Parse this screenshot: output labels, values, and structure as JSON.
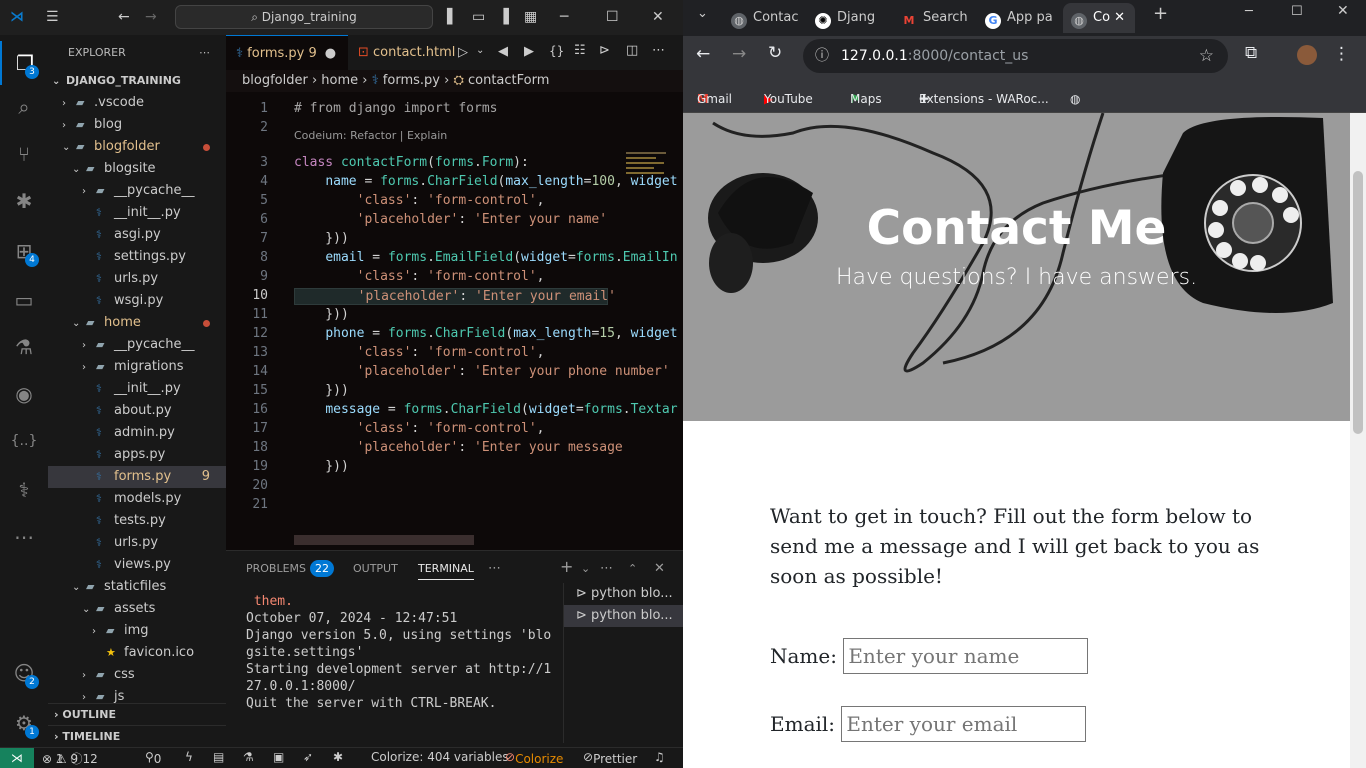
{
  "vscode": {
    "command_center": "Django_training",
    "explorer_title": "EXPLORER",
    "project": "DJANGO_TRAINING",
    "tree": [
      {
        "label": ".vscode",
        "type": "folder",
        "indent": 1
      },
      {
        "label": "blog",
        "type": "folder",
        "indent": 1
      },
      {
        "label": "blogfolder",
        "type": "folder-open",
        "indent": 1,
        "modified": true
      },
      {
        "label": "blogsite",
        "type": "folder-open",
        "indent": 2
      },
      {
        "label": "__pycache__",
        "type": "folder",
        "indent": 3
      },
      {
        "label": "__init__.py",
        "type": "py",
        "indent": 3
      },
      {
        "label": "asgi.py",
        "type": "py",
        "indent": 3
      },
      {
        "label": "settings.py",
        "type": "py",
        "indent": 3
      },
      {
        "label": "urls.py",
        "type": "py",
        "indent": 3
      },
      {
        "label": "wsgi.py",
        "type": "py",
        "indent": 3
      },
      {
        "label": "home",
        "type": "folder-open",
        "indent": 2,
        "modified": true
      },
      {
        "label": "__pycache__",
        "type": "folder",
        "indent": 3
      },
      {
        "label": "migrations",
        "type": "folder",
        "indent": 3
      },
      {
        "label": "__init__.py",
        "type": "py",
        "indent": 3
      },
      {
        "label": "about.py",
        "type": "py",
        "indent": 3
      },
      {
        "label": "admin.py",
        "type": "py",
        "indent": 3
      },
      {
        "label": "apps.py",
        "type": "py",
        "indent": 3
      },
      {
        "label": "forms.py",
        "type": "py",
        "indent": 3,
        "selected": true,
        "count": "9"
      },
      {
        "label": "models.py",
        "type": "py",
        "indent": 3
      },
      {
        "label": "tests.py",
        "type": "py",
        "indent": 3
      },
      {
        "label": "urls.py",
        "type": "py",
        "indent": 3
      },
      {
        "label": "views.py",
        "type": "py",
        "indent": 3
      },
      {
        "label": "staticfiles",
        "type": "folder-open",
        "indent": 2
      },
      {
        "label": "assets",
        "type": "folder-open",
        "indent": 3
      },
      {
        "label": "img",
        "type": "folder",
        "indent": 4
      },
      {
        "label": "favicon.ico",
        "type": "ico",
        "indent": 4
      },
      {
        "label": "css",
        "type": "folder",
        "indent": 3
      },
      {
        "label": "js",
        "type": "folder",
        "indent": 3
      }
    ],
    "sections": [
      "OUTLINE",
      "TIMELINE"
    ],
    "activity_badges": {
      "explorer": "3",
      "extensions": "4",
      "accounts": "2",
      "remote": "1"
    },
    "tabs": [
      {
        "label": "forms.py 9",
        "active": true
      },
      {
        "label": "contact.html",
        "active": false
      }
    ],
    "breadcrumb": [
      "blogfolder",
      "home",
      "forms.py",
      "contactForm"
    ],
    "codelens": "Codeium: Refactor | Explain",
    "code_lines": [
      {
        "n": "1",
        "html": "<span class='c'># from django import forms</span>"
      },
      {
        "n": "2",
        "html": ""
      },
      {
        "n": "3",
        "html": "<span class='k'>class</span> <span class='t'>contactForm</span>(<span class='t'>forms</span>.<span class='t'>Form</span>):"
      },
      {
        "n": "4",
        "html": "    <span class='p'>name</span> = <span class='t'>forms</span>.<span class='t'>CharField</span>(<span class='p'>max_length</span>=<span class='n'>100</span>, <span class='p'>widget</span>"
      },
      {
        "n": "5",
        "html": "        <span class='s'>'class'</span>: <span class='s'>'form-control'</span>,"
      },
      {
        "n": "6",
        "html": "        <span class='s'>'placeholder'</span>: <span class='s'>'Enter your name'</span>"
      },
      {
        "n": "7",
        "html": "    }))"
      },
      {
        "n": "8",
        "html": "    <span class='p'>email</span> = <span class='t'>forms</span>.<span class='t'>EmailField</span>(<span class='p'>widget</span>=<span class='t'>forms</span>.<span class='t'>EmailIn</span>"
      },
      {
        "n": "9",
        "html": "        <span class='s'>'class'</span>: <span class='s'>'form-control'</span>,"
      },
      {
        "n": "10",
        "html": "        <span class='s'>'placeholder'</span>: <span class='s'>'Enter your email'</span>",
        "current": true
      },
      {
        "n": "11",
        "html": "    }))"
      },
      {
        "n": "12",
        "html": "    <span class='p'>phone</span> = <span class='t'>forms</span>.<span class='t'>CharField</span>(<span class='p'>max_length</span>=<span class='n'>15</span>, <span class='p'>widget</span>"
      },
      {
        "n": "13",
        "html": "        <span class='s'>'class'</span>: <span class='s'>'form-control'</span>,"
      },
      {
        "n": "14",
        "html": "        <span class='s'>'placeholder'</span>: <span class='s'>'Enter your phone number'</span>"
      },
      {
        "n": "15",
        "html": "    }))"
      },
      {
        "n": "16",
        "html": "    <span class='p'>message</span> = <span class='t'>forms</span>.<span class='t'>CharField</span>(<span class='p'>widget</span>=<span class='t'>forms</span>.<span class='t'>Textar</span>"
      },
      {
        "n": "17",
        "html": "        <span class='s'>'class'</span>: <span class='s'>'form-control'</span>,"
      },
      {
        "n": "18",
        "html": "        <span class='s'>'placeholder'</span>: <span class='s'>'Enter your message</span>"
      },
      {
        "n": "19",
        "html": "    }))"
      },
      {
        "n": "20",
        "html": ""
      },
      {
        "n": "21",
        "html": ""
      }
    ],
    "panel_tabs": {
      "problems": "PROBLEMS",
      "problems_count": "22",
      "output": "OUTPUT",
      "terminal": "TERMINAL"
    },
    "terminal_lines": [
      " them.",
      "October 07, 2024 - 12:47:51",
      "Django version 5.0, using settings 'blo",
      "gsite.settings'",
      "Starting development server at http://1",
      "27.0.0.1:8000/",
      "Quit the server with CTRL-BREAK."
    ],
    "terminal_list": [
      "python blo...",
      "python blo..."
    ],
    "status": {
      "errors": "1",
      "warnings": "9",
      "info": "12",
      "ports": "0",
      "colorize": "Colorize: 404 variables",
      "colorize_btn": "Colorize",
      "prettier": "Prettier"
    }
  },
  "chrome": {
    "tabs": [
      {
        "label": "Contac",
        "icon": "globe-icon"
      },
      {
        "label": "Djang",
        "icon": "openai-icon"
      },
      {
        "label": "Search",
        "icon": "gmail-icon"
      },
      {
        "label": "App pa",
        "icon": "google-icon"
      },
      {
        "label": "Co",
        "icon": "globe-icon",
        "active": true
      }
    ],
    "url_host": "127.0.0.1",
    "url_rest": ":8000/contact_us",
    "bookmarks": [
      "Gmail",
      "YouTube",
      "Maps",
      "Extensions - WARoc..."
    ],
    "page": {
      "title": "Contact Me",
      "subtitle": "Have questions? I have answers.",
      "intro": "Want to get in touch? Fill out the form below to send me a message and I will get back to you as soon as possible!",
      "name_label": "Name:",
      "name_placeholder": "Enter your name",
      "email_label": "Email:",
      "email_placeholder": "Enter your email"
    }
  }
}
